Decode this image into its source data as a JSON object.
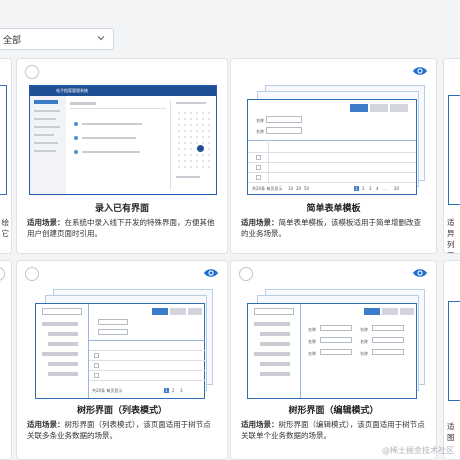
{
  "filter": {
    "selected": "全部"
  },
  "cards": [
    {
      "title": "录入已有界面",
      "label": "适用场景：",
      "desc": "在系统中录入线下开发的特殊界面，方便其他用户创建页面时引用。"
    },
    {
      "title": "简单表单模板",
      "label": "适用场景：",
      "desc": "简单表单模板，该模板适用于简单增删改查的业务场景。"
    },
    {
      "title": "树形界面（列表模式）",
      "label": "适用场景：",
      "desc": "树形界面（列表模式），该页面适用于树节点关联多条业务数据的场景。"
    },
    {
      "title": "树形界面（编辑模式）",
      "label": "适用场景：",
      "desc": "树形界面（编辑模式），该页面适用于树节点关联单个业务数据的场景。"
    }
  ],
  "thumb_text": {
    "app_title": "电子档案管理系统",
    "field_label": "名称",
    "pager_total": "共20条 每页显示",
    "page_sizes": [
      "10",
      "20",
      "50"
    ],
    "pages": [
      "1",
      "2",
      "3",
      "4",
      "...",
      "20"
    ]
  },
  "edge_text": {
    "left_col": [
      "绘",
      "它"
    ],
    "right_col": [
      "适",
      "异",
      "列",
      "面，"
    ],
    "right_bottom": [
      "适",
      "图"
    ]
  },
  "watermark": "@稀土掘金技术社区",
  "colors": {
    "accent": "#3d7cc9",
    "eye": "#1e6fd0"
  }
}
